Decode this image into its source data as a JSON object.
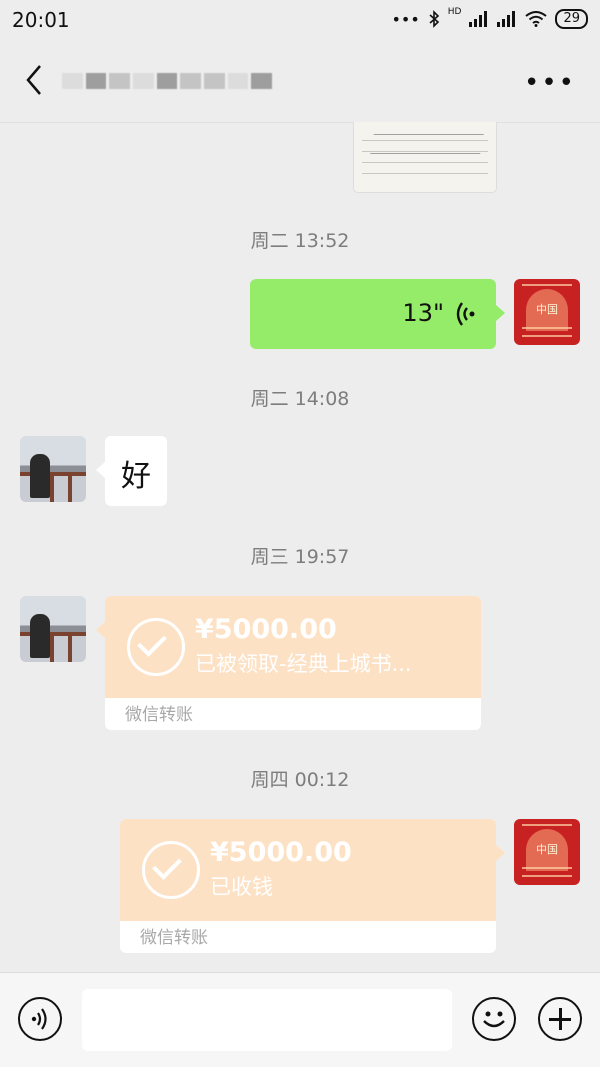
{
  "status_bar": {
    "time": "20:01",
    "hd": "HD",
    "battery": "29"
  },
  "nav": {
    "more": "•••"
  },
  "messages": {
    "ts1": "周二 13:52",
    "voice_duration": "13\"",
    "ts2": "周二 14:08",
    "reply": "好",
    "ts3": "周三 19:57",
    "transfer1": {
      "amount": "¥5000.00",
      "status": "已被领取-经典上城书...",
      "label": "微信转账"
    },
    "ts4": "周四 00:12",
    "transfer2": {
      "amount": "¥5000.00",
      "status": "已收钱",
      "label": "微信转账"
    }
  },
  "avatar_badge": "中国",
  "colors": {
    "sent_bubble": "#95ec69",
    "transfer_bg": "#fde1c4",
    "page_bg": "#ededed"
  }
}
